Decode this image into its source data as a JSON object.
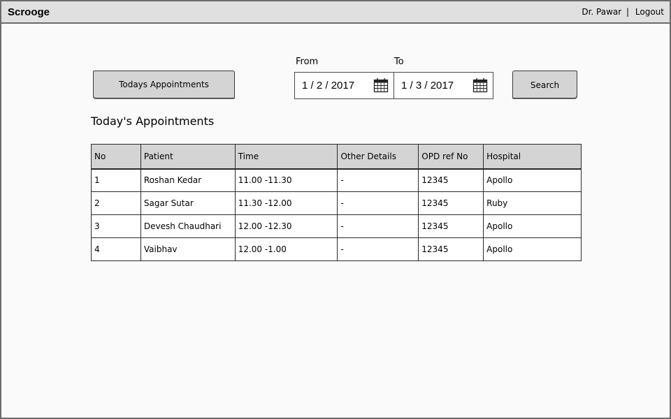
{
  "app": {
    "title": "Scrooge"
  },
  "header": {
    "user_name": "Dr. Pawar",
    "separator": "|",
    "logout_label": "Logout"
  },
  "toolbar": {
    "today_button_label": "Todays Appointments",
    "from_label": "From",
    "to_label": "To",
    "from_date": "1 / 2 / 2017",
    "to_date": "1 / 3 / 2017",
    "search_button_label": "Search",
    "calendar_icon": "calendar-icon"
  },
  "section": {
    "title": "Today's Appointments"
  },
  "table": {
    "columns": [
      "No",
      "Patient",
      "Time",
      "Other Details",
      "OPD ref No",
      "Hospital"
    ],
    "rows": [
      [
        "1",
        "Roshan Kedar",
        "11.00 -11.30",
        "-",
        "12345",
        "Apollo"
      ],
      [
        "2",
        "Sagar Sutar",
        "11.30 -12.00",
        "-",
        "12345",
        "Ruby"
      ],
      [
        "3",
        "Devesh Chaudhari",
        "12.00 -12.30",
        "-",
        "12345",
        "Apollo"
      ],
      [
        "4",
        "Vaibhav",
        "12.00 -1.00",
        "-",
        "12345",
        "Apollo"
      ]
    ]
  },
  "colors": {
    "titlebar": "#e0e0e0",
    "button": "#d4d4d4",
    "border": "#2a2a2a",
    "background": "#fafafa"
  }
}
